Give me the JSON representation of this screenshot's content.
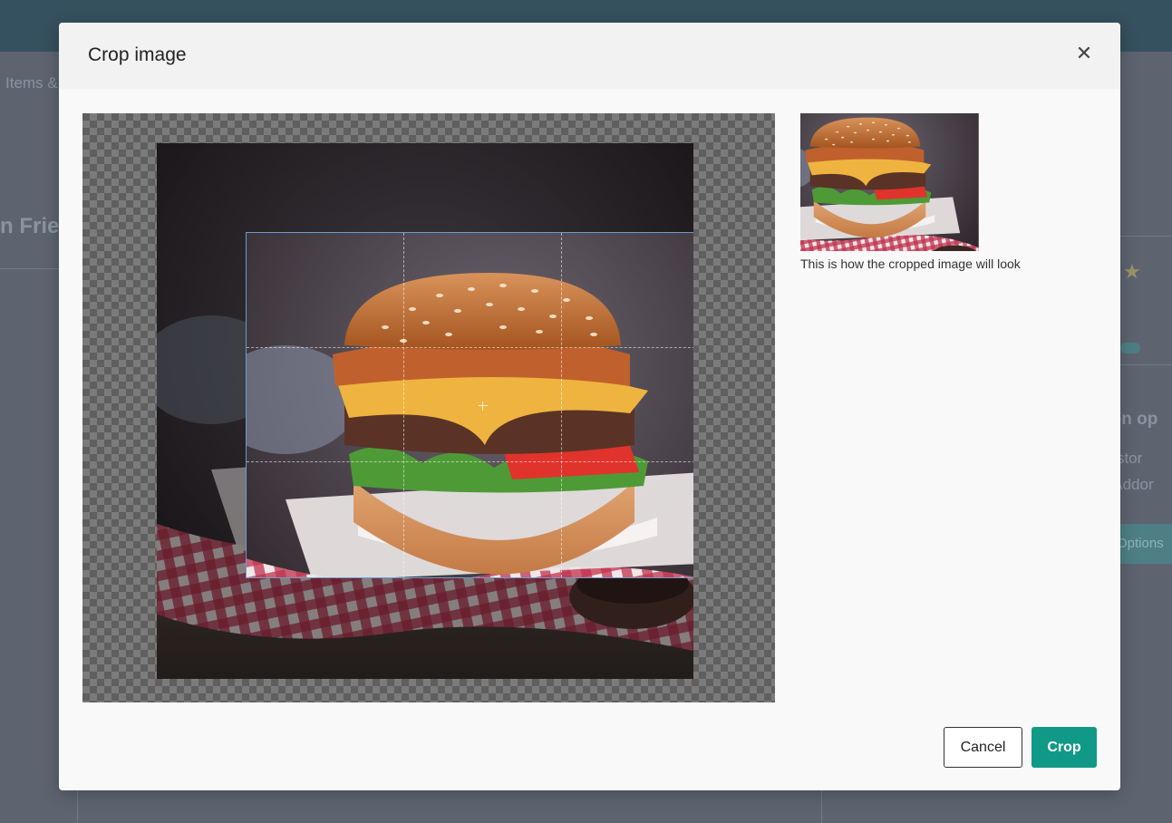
{
  "background": {
    "breadcrumb": "Items &",
    "item_title": "n Fries",
    "section_heading": "tion op",
    "section_text_1": "custor",
    "section_text_2": "d Addor",
    "options_button": "Options"
  },
  "modal": {
    "title": "Crop image",
    "close_icon": "close-icon",
    "preview_caption": "This is how the cropped image will look",
    "cancel_label": "Cancel",
    "crop_label": "Crop"
  },
  "image": {
    "subject": "burger-photo"
  },
  "colors": {
    "accent": "#119987",
    "topbar": "#35505e",
    "crop_border": "#6a9ccc"
  }
}
